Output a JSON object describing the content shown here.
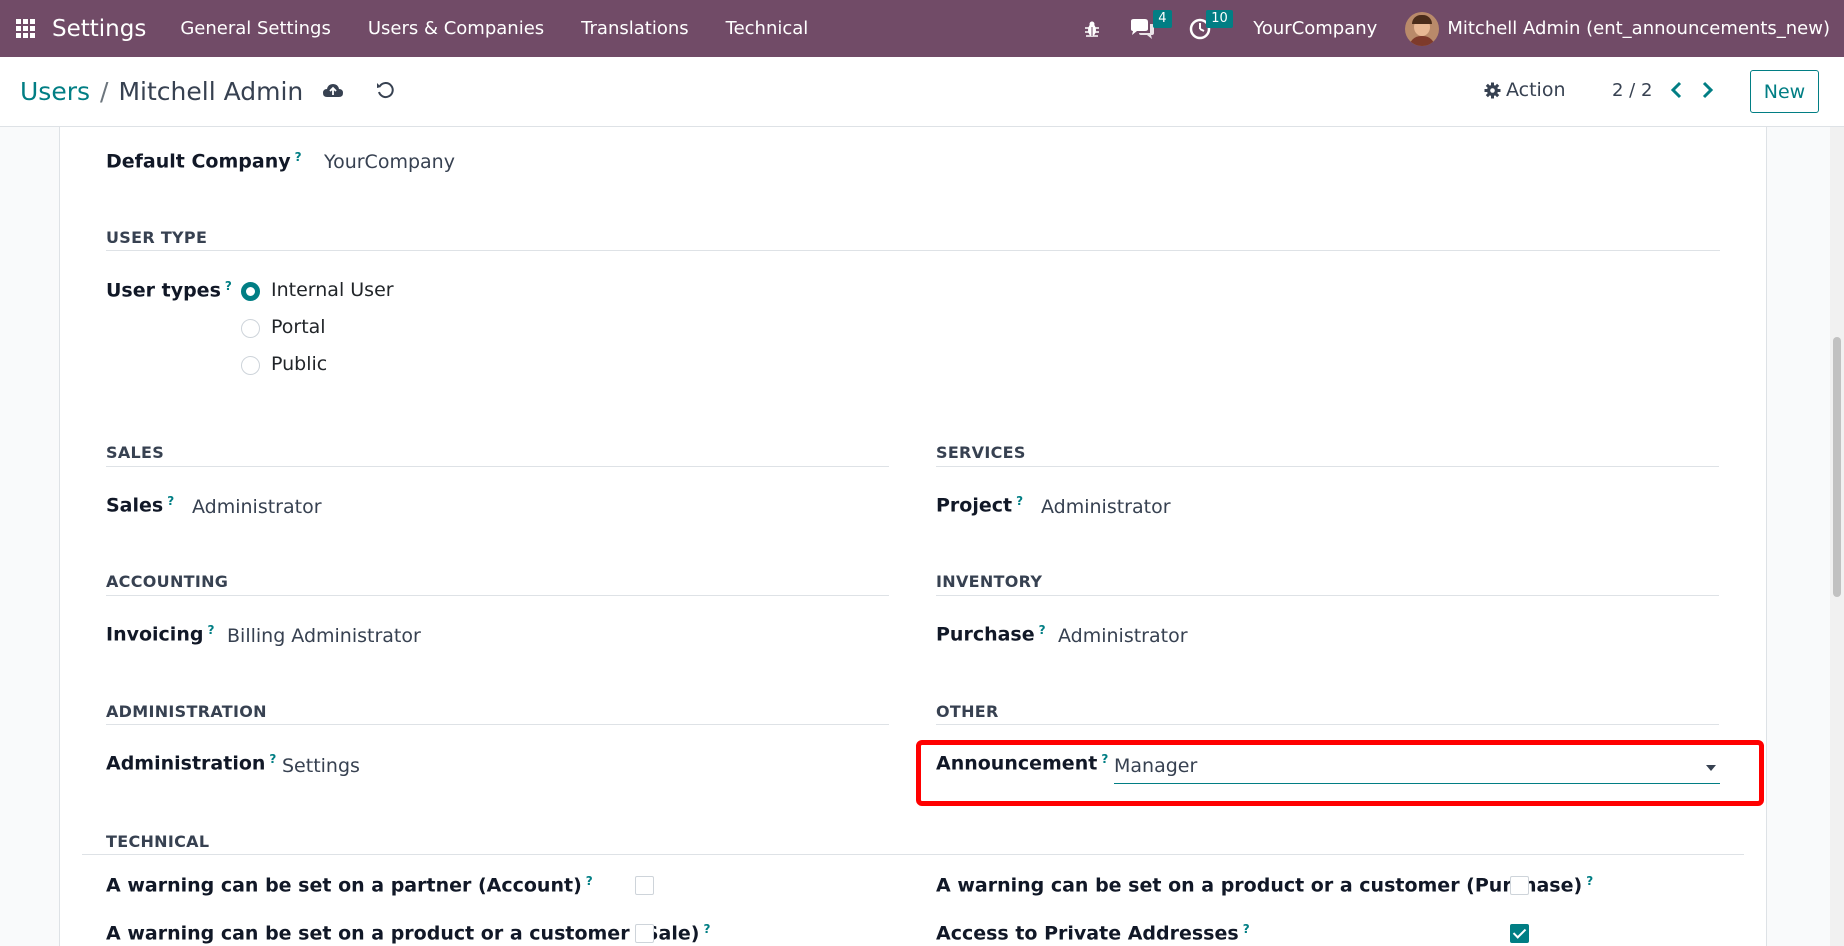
{
  "navbar": {
    "app_name": "Settings",
    "menu": [
      "General Settings",
      "Users & Companies",
      "Translations",
      "Technical"
    ],
    "messages_count": "4",
    "activities_count": "10",
    "company": "YourCompany",
    "user": "Mitchell Admin (ent_announcements_new)",
    "bg_color": "#714B67"
  },
  "control": {
    "breadcrumb_parent": "Users",
    "breadcrumb_separator": "/",
    "breadcrumb_current": "Mitchell Admin",
    "action_label": "Action",
    "pager": "2 / 2",
    "new_label": "New"
  },
  "form": {
    "default_company_label": "Default Company",
    "default_company_value": "YourCompany",
    "help_mark": "?",
    "user_type_section": "USER TYPE",
    "user_types_label": "User types",
    "user_types": [
      "Internal User",
      "Portal",
      "Public"
    ],
    "user_type_selected": "Internal User",
    "sales_section": "SALES",
    "sales_label": "Sales",
    "sales_value": "Administrator",
    "services_section": "SERVICES",
    "project_label": "Project",
    "project_value": "Administrator",
    "accounting_section": "ACCOUNTING",
    "invoicing_label": "Invoicing",
    "invoicing_value": "Billing Administrator",
    "inventory_section": "INVENTORY",
    "purchase_label": "Purchase",
    "purchase_value": "Administrator",
    "administration_section": "ADMINISTRATION",
    "administration_label": "Administration",
    "administration_value": "Settings",
    "other_section": "OTHER",
    "announcement_label": "Announcement",
    "announcement_value": "Manager",
    "technical_section": "TECHNICAL",
    "technical": [
      {
        "label": "A warning can be set on a partner (Account)",
        "checked": false
      },
      {
        "label": "A warning can be set on a product or a customer (Purchase)",
        "checked": false
      },
      {
        "label": "A warning can be set on a product or a customer (Sale)",
        "checked": false
      },
      {
        "label": "Access to Private Addresses",
        "checked": true
      }
    ]
  },
  "accent_color": "#017E84",
  "highlight_color": "#ff0000"
}
